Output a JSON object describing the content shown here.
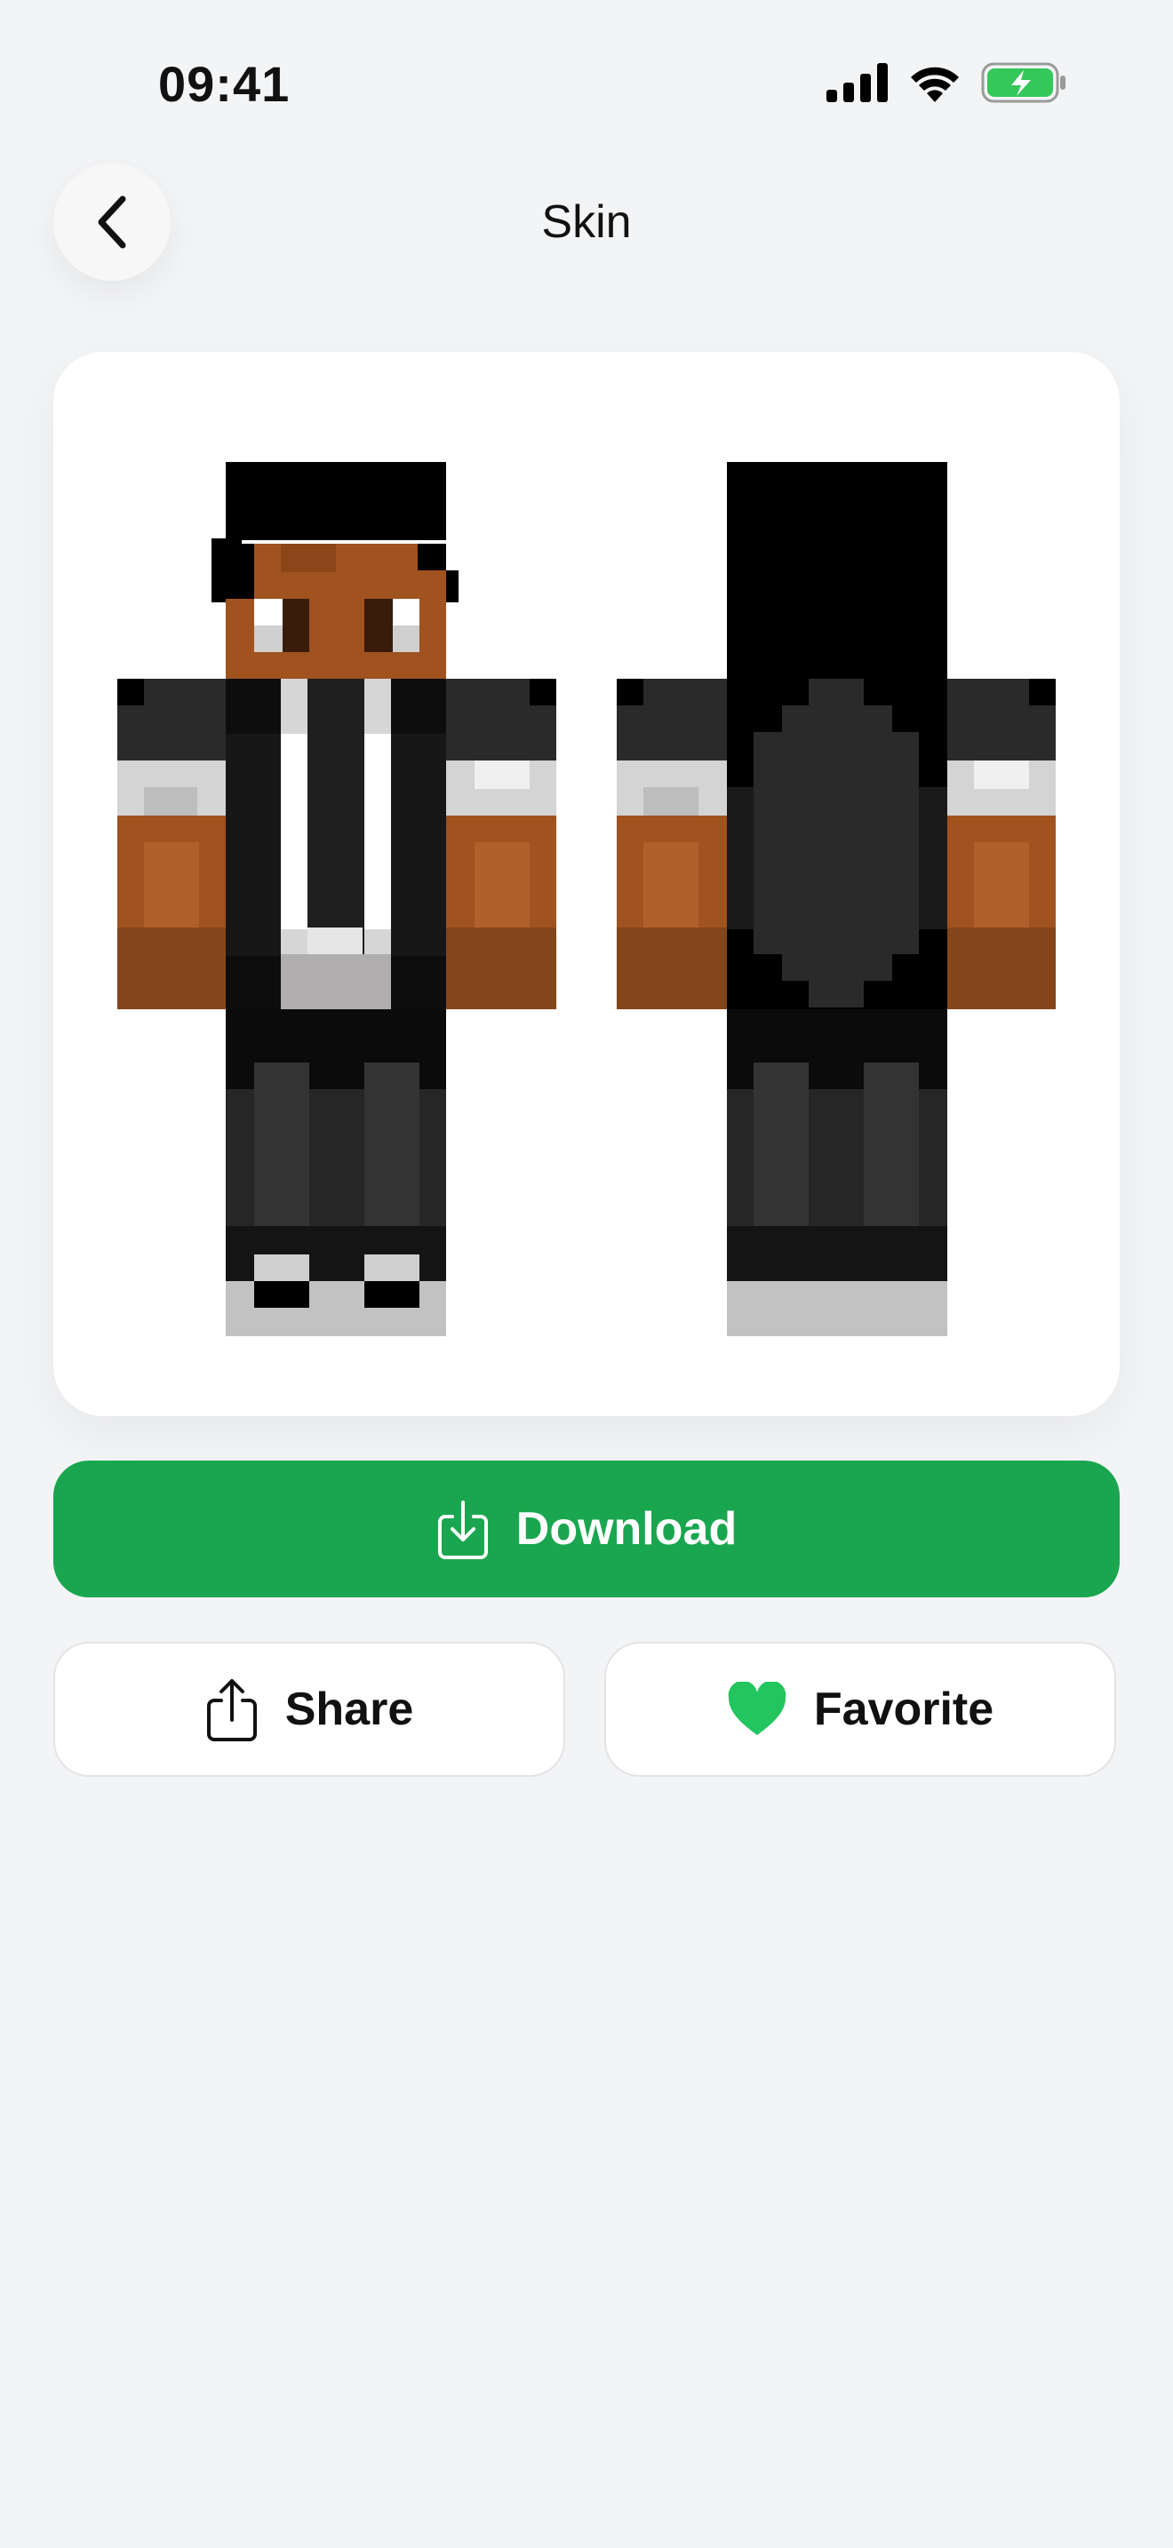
{
  "status_bar": {
    "time": "09:41"
  },
  "header": {
    "title": "Skin"
  },
  "actions": {
    "download_label": "Download",
    "share_label": "Share",
    "favorite_label": "Favorite"
  },
  "colors": {
    "accent_green": "#1aa64f",
    "favorite_heart": "#22c55e",
    "battery_green": "#34c759",
    "background": "#f3f4f6"
  },
  "icons": {
    "back": "chevron-left-icon",
    "download": "download-icon",
    "share": "share-icon",
    "favorite": "heart-icon",
    "signal": "cellular-signal-icon",
    "wifi": "wifi-icon",
    "battery": "battery-charging-icon"
  },
  "preview": {
    "views": [
      "front",
      "back"
    ]
  }
}
